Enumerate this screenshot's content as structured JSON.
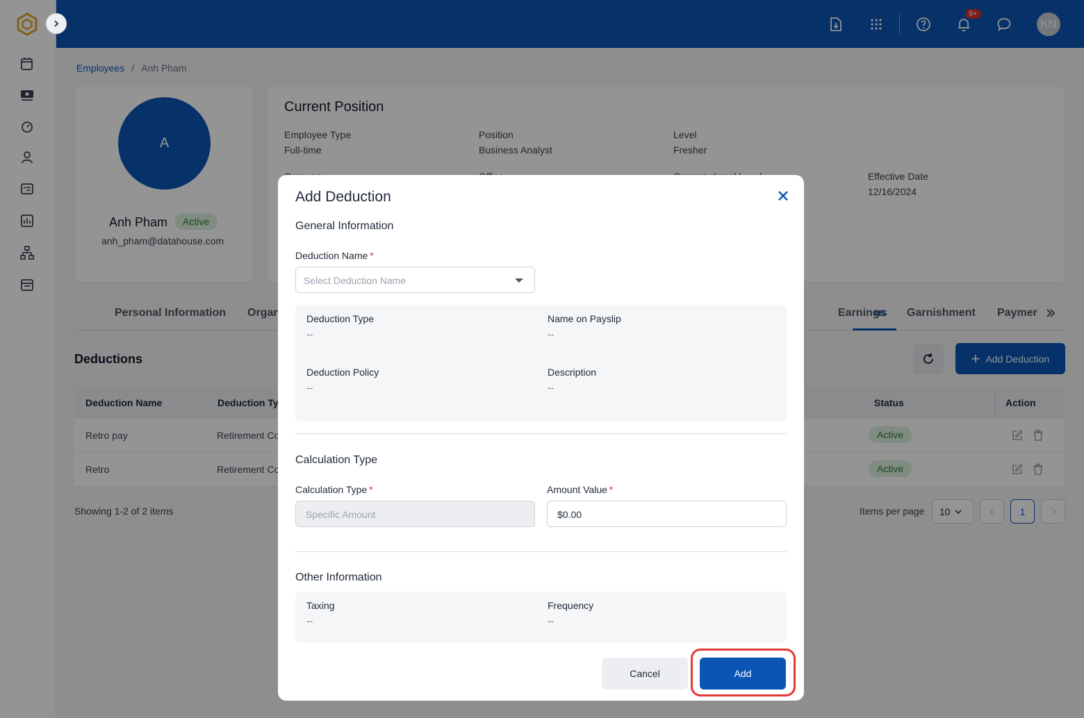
{
  "header": {
    "avatar_initials": "KN",
    "notification_badge": "9+",
    "brand_color": "#0b55b5"
  },
  "sidebar": {
    "icons": [
      "calendar-edit-icon",
      "money-icon",
      "timer-icon",
      "person-icon",
      "checklist-icon",
      "chart-icon",
      "org-chart-icon",
      "calendar-icon"
    ]
  },
  "breadcrumb": {
    "parent": "Employees",
    "separator": "/",
    "current": "Anh Pham"
  },
  "profile": {
    "avatar_letter": "A",
    "name": "Anh Pham",
    "status": "Active",
    "email": "anh_pham@datahouse.com"
  },
  "position": {
    "title": "Current Position",
    "employee_type_label": "Employee Type",
    "employee_type": "Full-time",
    "position_label": "Position",
    "position_value": "Business Analyst",
    "level_label": "Level",
    "level_value": "Fresher",
    "company_label": "Company",
    "office_label": "Office",
    "org_level_label": "Organizational Level",
    "effective_date_label": "Effective Date",
    "effective_date": "12/16/2024"
  },
  "tabs": {
    "personal": "Personal Information",
    "org": "Organ",
    "deductions": "ns",
    "earnings": "Earnings",
    "garnishment": "Garnishment",
    "payment": "Paymer"
  },
  "deductions": {
    "title": "Deductions",
    "add_button": "Add Deduction",
    "columns": {
      "name": "Deduction Name",
      "type": "Deduction Ty",
      "status": "Status",
      "action": "Action"
    },
    "rows": [
      {
        "name": "Retro pay",
        "type": "Retirement Co",
        "status": "Active"
      },
      {
        "name": "Retro",
        "type": "Retirement Co",
        "status": "Active"
      }
    ],
    "showing": "Showing 1-2 of 2 items",
    "items_per_page_label": "Items per page",
    "items_per_page": "10",
    "current_page": "1"
  },
  "modal": {
    "title": "Add Deduction",
    "general_section": "General Information",
    "deduction_name_label": "Deduction Name",
    "required_mark": "*",
    "deduction_name_placeholder": "Select Deduction Name",
    "deduction_type_label": "Deduction Type",
    "deduction_type_value": "--",
    "name_on_payslip_label": "Name on Payslip",
    "name_on_payslip_value": "--",
    "deduction_policy_label": "Deduction Policy",
    "deduction_policy_value": "--",
    "description_label": "Description",
    "description_value": "--",
    "calc_section": "Calculation Type",
    "calc_type_label": "Calculation Type",
    "calc_type_value": "Specific Amount",
    "amount_label": "Amount Value",
    "amount_value": "$0.00",
    "other_section": "Other Information",
    "taxing_label": "Taxing",
    "taxing_value": "--",
    "frequency_label": "Frequency",
    "frequency_value": "--",
    "cancel_label": "Cancel",
    "add_label": "Add"
  }
}
